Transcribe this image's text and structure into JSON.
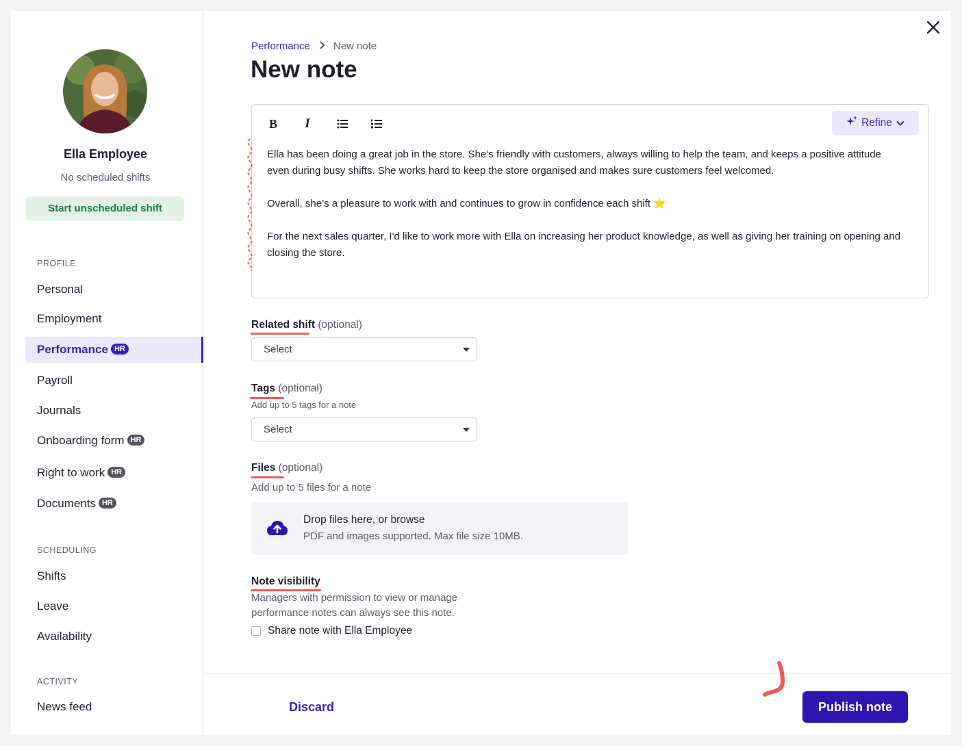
{
  "employee": {
    "name": "Ella Employee",
    "status": "No scheduled shifts",
    "start_shift_label": "Start unscheduled shift"
  },
  "sidebar": {
    "profile_heading": "PROFILE",
    "profile_items": [
      {
        "label": "Personal",
        "hr": false
      },
      {
        "label": "Employment",
        "hr": false
      },
      {
        "label": "Performance",
        "hr": true,
        "active": true
      },
      {
        "label": "Payroll",
        "hr": false
      },
      {
        "label": "Journals",
        "hr": false
      },
      {
        "label": "Onboarding form",
        "hr": true
      },
      {
        "label": "Right to work",
        "hr": true
      },
      {
        "label": "Documents",
        "hr": true
      }
    ],
    "scheduling_heading": "SCHEDULING",
    "scheduling_items": [
      {
        "label": "Shifts"
      },
      {
        "label": "Leave"
      },
      {
        "label": "Availability"
      }
    ],
    "activity_heading": "ACTIVITY",
    "activity_items": [
      {
        "label": "News feed"
      }
    ],
    "hr_badge": "HR"
  },
  "breadcrumb": {
    "parent": "Performance",
    "current": "New note"
  },
  "page_title": "New note",
  "editor": {
    "toolbar": {
      "bold": "B",
      "italic": "I",
      "refine_label": "Refine"
    },
    "paragraphs": [
      "Ella has been doing a great job in the store. She’s friendly with customers, always willing to help the team, and keeps a positive attitude even during busy shifts. She works hard to keep the store organised and makes sure customers feel welcomed.",
      "Overall, she’s a pleasure to work with and continues to grow in confidence each shift ⭐",
      "For the next sales quarter, I'd like to work more with Ella on increasing her product knowledge, as well as giving her training on opening and closing the store."
    ]
  },
  "related_shift": {
    "label": "Related shift",
    "optional": "(optional)",
    "value": "Select"
  },
  "tags": {
    "label": "Tags",
    "optional": "(optional)",
    "help": "Add up to 5 tags for a note",
    "value": "Select"
  },
  "files": {
    "label": "Files",
    "optional": "(optional)",
    "help": "Add up to 5 files for a note",
    "drop_title": "Drop files here, or browse",
    "drop_sub": "PDF and images supported. Max file size 10MB."
  },
  "visibility": {
    "label": "Note visibility",
    "help_line1": "Managers with permission to view or manage",
    "help_line2": "performance notes can always see this note.",
    "checkbox_label": "Share note with Ella Employee",
    "checked": false
  },
  "footer": {
    "discard_label": "Discard",
    "publish_label": "Publish note"
  },
  "colors": {
    "brand": "#3015b0",
    "accent_bg": "#ebe8fb",
    "success_bg": "#e2f3e6",
    "success_text": "#1d7a3a",
    "annotation": "#ef5a56"
  }
}
